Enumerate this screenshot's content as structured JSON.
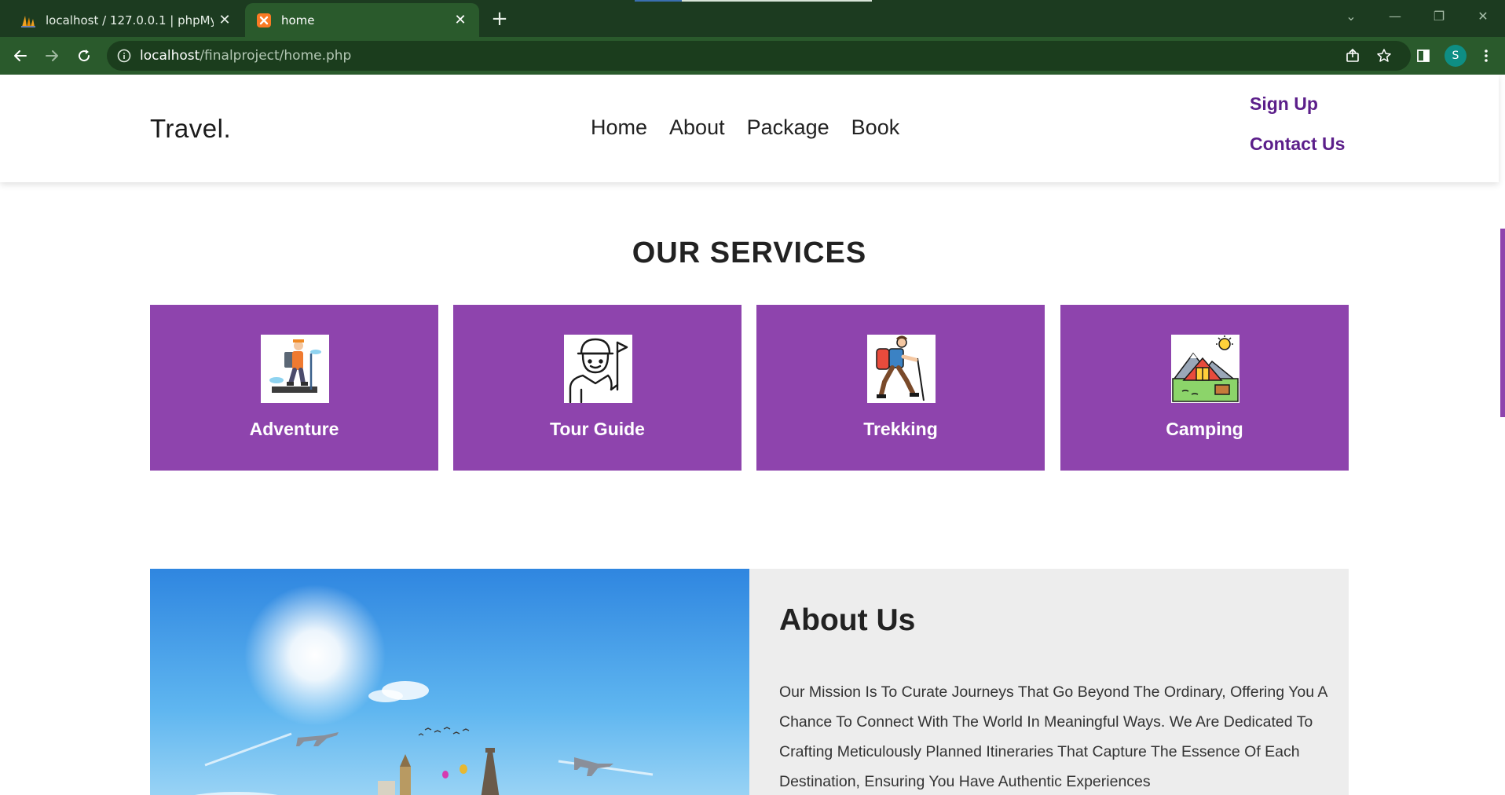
{
  "browser": {
    "tabs": [
      {
        "title": "localhost / 127.0.0.1 | phpMyAdmin",
        "active": false
      },
      {
        "title": "home",
        "active": true
      }
    ],
    "new_tab_symbol": "+",
    "url_host": "localhost",
    "url_path": "/finalproject/home.php",
    "profile_initial": "S",
    "theme_color": "#2a5a2c"
  },
  "site": {
    "logo": "Travel.",
    "nav": [
      "Home",
      "About",
      "Package",
      "Book"
    ],
    "header_links": {
      "sign_up": "Sign Up",
      "contact_us": "Contact Us"
    },
    "accent_color": "#8e44ad"
  },
  "services": {
    "title": "OUR SERVICES",
    "items": [
      {
        "label": "Adventure",
        "icon": "hiker-icon"
      },
      {
        "label": "Tour Guide",
        "icon": "tour-guide-icon"
      },
      {
        "label": "Trekking",
        "icon": "trekker-icon"
      },
      {
        "label": "Camping",
        "icon": "camping-tent-icon"
      }
    ]
  },
  "about": {
    "title": "About Us",
    "text": "Our Mission Is To Curate Journeys That Go Beyond The Ordinary, Offering You A Chance To Connect With The World In Meaningful Ways. We Are Dedicated To Crafting Meticulously Planned Itineraries That Capture The Essence Of Each Destination, Ensuring You Have Authentic Experiences"
  }
}
